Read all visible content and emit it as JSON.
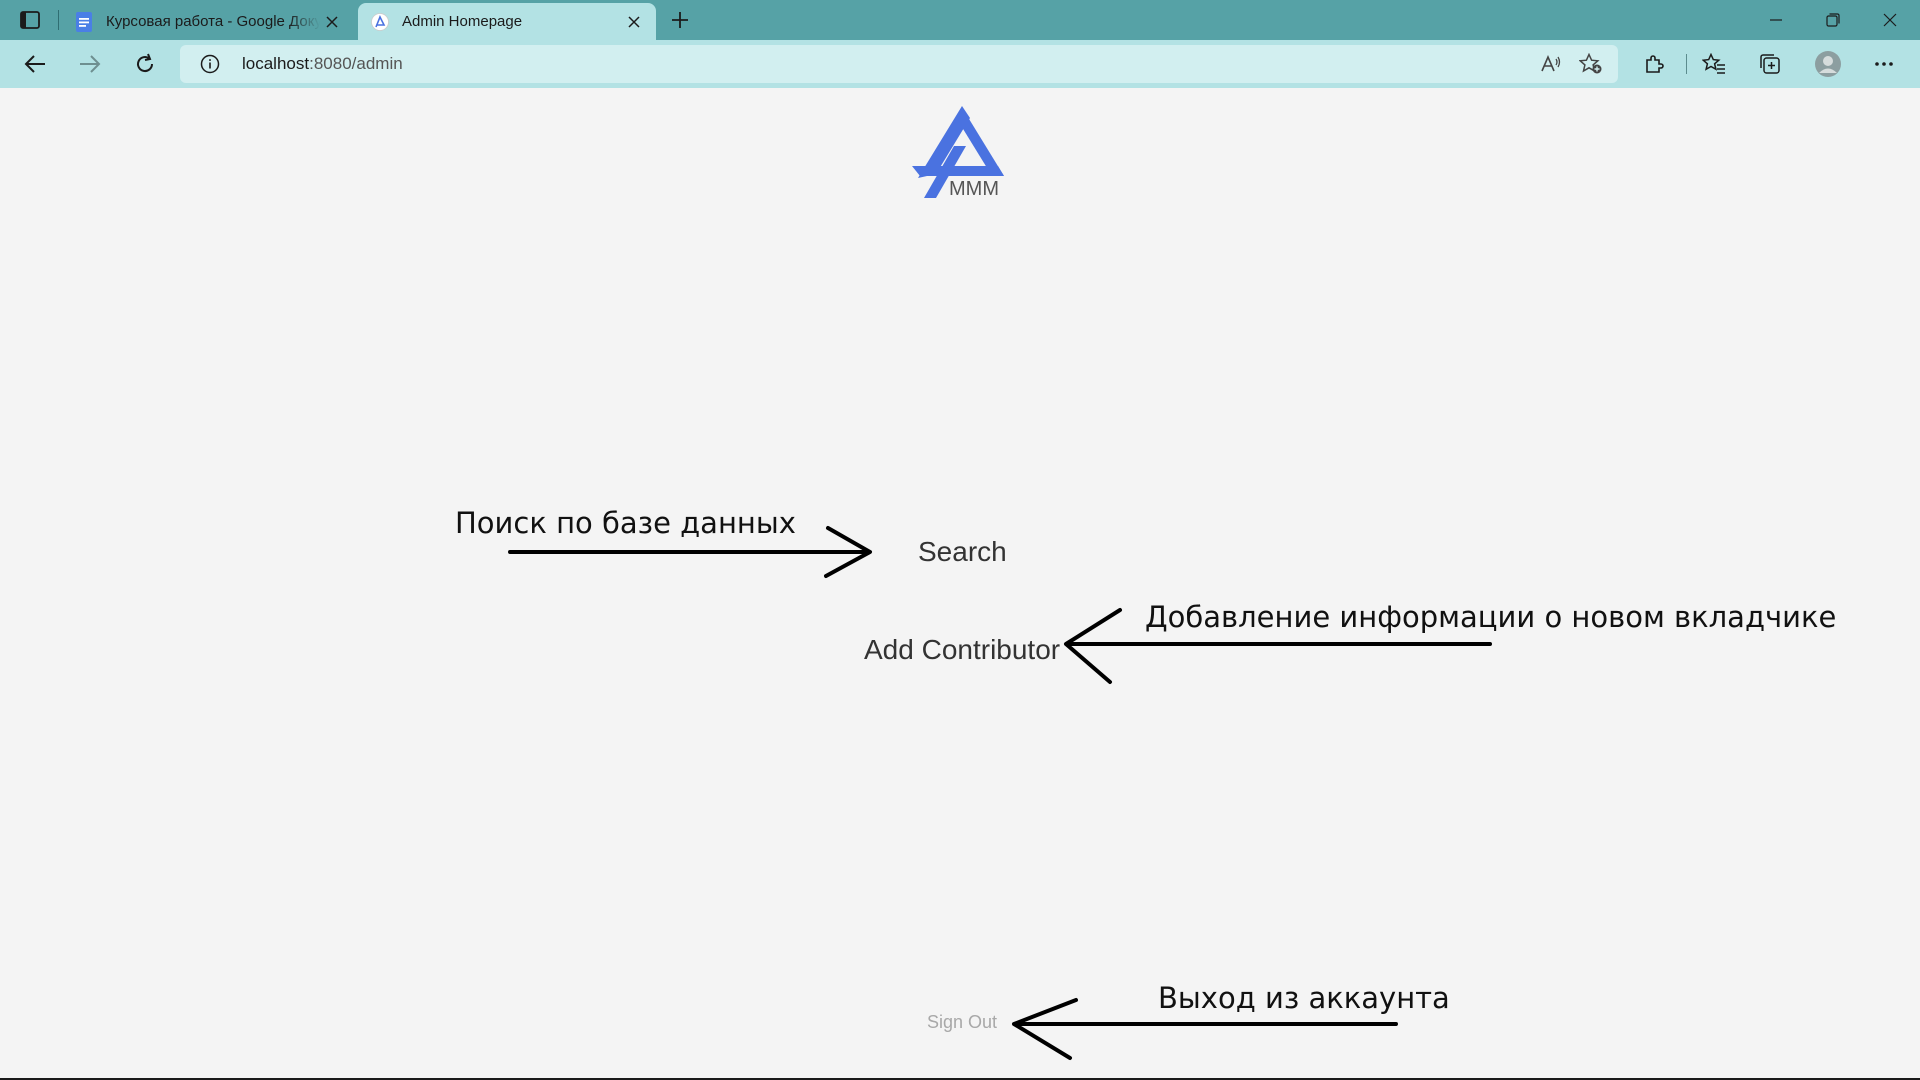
{
  "browser": {
    "tabs": [
      {
        "title": "Курсовая работа - Google Документы",
        "favicon": "google-docs-icon",
        "active": false
      },
      {
        "title": "Admin Homepage",
        "favicon": "mmm-logo-icon",
        "active": true
      }
    ],
    "address": {
      "host": "localhost",
      "path": ":8080/admin"
    },
    "chrome_color": "#56a2a6",
    "toolbar_color": "#b3e2e4"
  },
  "page": {
    "logo_text": "MMM",
    "logo_color": "#4a72e0",
    "links": {
      "search": "Search",
      "add_contributor": "Add Contributor",
      "sign_out": "Sign Out"
    },
    "annotations": {
      "search": "Поиск по базе данных",
      "add_contributor": "Добавление информации о новом вкладчике",
      "sign_out": "Выход из аккаунта"
    }
  }
}
